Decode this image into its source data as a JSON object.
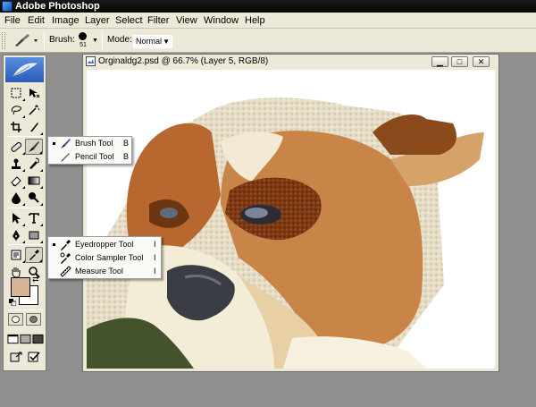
{
  "app": {
    "title": "Adobe Photoshop"
  },
  "menu": [
    "File",
    "Edit",
    "Image",
    "Layer",
    "Select",
    "Filter",
    "View",
    "Window",
    "Help"
  ],
  "options": {
    "brush_label": "Brush:",
    "brush_size": "51",
    "mode_label": "Mode:",
    "mode_value": "Normal"
  },
  "document": {
    "title": "Orginaldg2.psd @ 66.7% (Layer 5, RGB/8)",
    "minimize_icon": "minimize-icon",
    "maximize_icon": "maximize-icon",
    "close_icon": "close-icon"
  },
  "brush_flyout": [
    {
      "label": "Brush Tool",
      "key": "B",
      "selected": true,
      "icon": "brush-icon"
    },
    {
      "label": "Pencil Tool",
      "key": "B",
      "selected": false,
      "icon": "pencil-icon"
    }
  ],
  "eyedropper_flyout": [
    {
      "label": "Eyedropper Tool",
      "key": "I",
      "selected": true,
      "icon": "eyedropper-icon"
    },
    {
      "label": "Color Sampler Tool",
      "key": "I",
      "selected": false,
      "icon": "color-sampler-icon"
    },
    {
      "label": "Measure Tool",
      "key": "I",
      "selected": false,
      "icon": "measure-icon"
    }
  ],
  "colors": {
    "foreground": "#d7b594",
    "background": "#ffffff",
    "workspace": "#8f8f8f"
  }
}
